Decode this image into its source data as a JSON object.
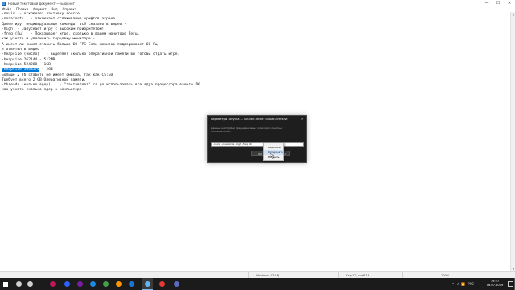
{
  "window": {
    "title": "Новый текстовый документ — Блокнот",
    "minimize_glyph": "—",
    "maximize_glyph": "☐",
    "close_glyph": "✕"
  },
  "menu": [
    "Файл",
    "Правка",
    "Формат",
    "Вид",
    "Справка"
  ],
  "editor": {
    "lines": [
      {
        "before": "-novid  - отключает заставку source",
        "sel": "",
        "after": ""
      },
      {
        "before": "-noaafonts   - отключает сглаживание шрифтов экрана",
        "sel": "",
        "after": ""
      },
      {
        "before": "Далее идут индивидуальные команды, всё сказано в видео -",
        "sel": "",
        "after": ""
      },
      {
        "before": "-high  - Запускает игру с высоким приоритетом!",
        "sel": "",
        "after": ""
      },
      {
        "before": "-freq (Гц)   - Показывает игре, сколько в вашем мониторе Гегц,",
        "sel": "",
        "after": ""
      },
      {
        "before": "как узнать и увеличить герцовку монитора -",
        "sel": "",
        "after": ""
      },
      {
        "before": "А имеет ли смысл ставить больше 60 FPS Если монитор поддерживает 60 Гц",
        "sel": "",
        "after": ""
      },
      {
        "before": "я ответил в видео -",
        "sel": "",
        "after": ""
      },
      {
        "before": "-heapsize (число)   - выделяет сколько оперативной памяти вы готовы отдать игре.",
        "sel": "",
        "after": ""
      },
      {
        "before": "-heapsize 262144 - 512MB",
        "sel": "",
        "after": ""
      },
      {
        "before": "-heapsize 524288 - 1GB",
        "sel": "",
        "after": ""
      },
      {
        "before": "",
        "sel": "-heapsize 1048576",
        "after": " - 2GB"
      },
      {
        "before": "Больше 2 Гб ставить не имеет смысла, так как CS:GO",
        "sel": "",
        "after": ""
      },
      {
        "before": "Требует всего 2 GB Оперативной памяти.",
        "sel": "",
        "after": ""
      },
      {
        "before": "-threads (кол-во ядер)    - \"заставляет\" cs go использовать все ядра процессора вашего ПК.",
        "sel": "",
        "after": ""
      },
      {
        "before": "как узнать сколько ядер в компьютере -",
        "sel": "",
        "after": ""
      }
    ]
  },
  "statusbar": {
    "encoding": "Windows (CRLF)",
    "position": "Стр 12, стлб 18",
    "zoom": "100%"
  },
  "dialog": {
    "title": "Параметры запуска — Counter-Strike: Global Offensive",
    "close_glyph": "✕",
    "description": "Данные настройки предназначены только для опытных пользователей.",
    "input_value": "-novid -noaafonts -high -freq 60",
    "ok_label": "OK",
    "cancel_label": "ОТМЕНА"
  },
  "context_menu": {
    "items": [
      "Выделить",
      "Копировать",
      "Вставить"
    ],
    "hover_index": 1
  },
  "taskbar": {
    "items": [
      {
        "name": "start",
        "color": "#ffffff"
      },
      {
        "name": "search",
        "color": "#d0d0d0"
      },
      {
        "name": "task-view",
        "color": "#d0d0d0"
      },
      {
        "name": "app-1",
        "color": "#c2185b"
      },
      {
        "name": "app-2",
        "color": "#2962ff"
      },
      {
        "name": "app-3",
        "color": "#7b1fa2"
      },
      {
        "name": "app-4",
        "color": "#1e88e5"
      },
      {
        "name": "app-5",
        "color": "#43a047"
      },
      {
        "name": "app-6",
        "color": "#ff9800"
      },
      {
        "name": "steam",
        "color": "#1976d2"
      },
      {
        "name": "app-8",
        "color": "#9e9e9e"
      },
      {
        "name": "notepad",
        "color": "#64b5f6"
      },
      {
        "name": "app-10",
        "color": "#e53935"
      },
      {
        "name": "app-11",
        "color": "#5c6bc0"
      }
    ],
    "tray": [
      "⌃",
      "♪",
      "📶",
      "РУС"
    ],
    "time": "19:27",
    "date": "06.07.2019"
  },
  "colors": {
    "selection": "#0078d7",
    "dialog_bg": "#1e1e1e",
    "taskbar_bg": "#1b1b1b"
  }
}
